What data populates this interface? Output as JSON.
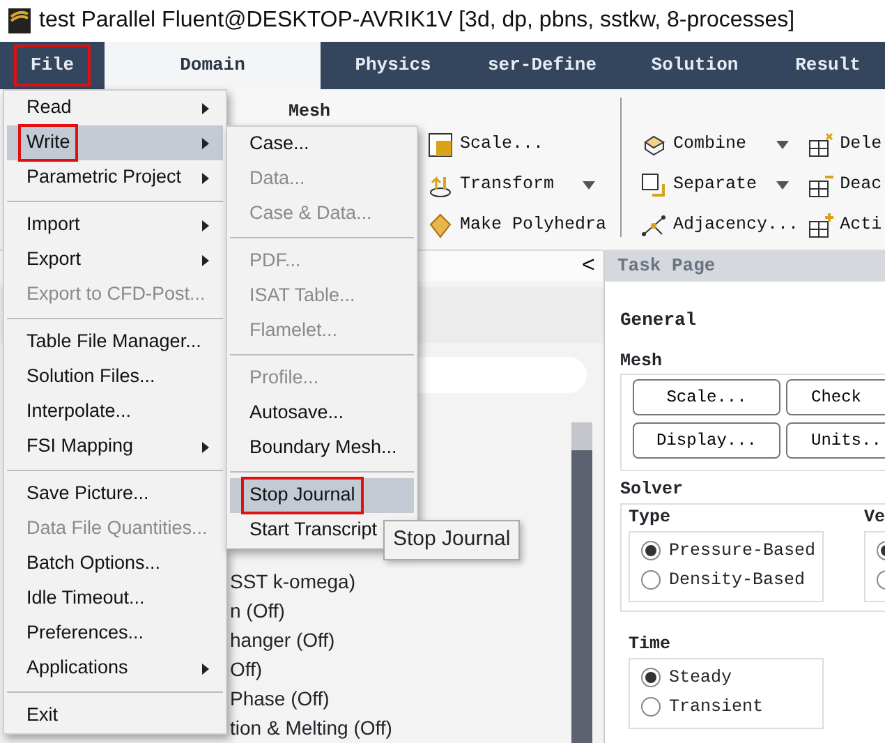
{
  "window": {
    "title": "test Parallel Fluent@DESKTOP-AVRIK1V  [3d, dp, pbns, sstkw, 8-processes]"
  },
  "tabs": [
    {
      "label": "File",
      "selected": false,
      "annotated": true
    },
    {
      "label": "Domain",
      "selected": true,
      "annotated": false
    },
    {
      "label": "Physics",
      "selected": false,
      "annotated": false
    },
    {
      "label": "ser-Define",
      "selected": false,
      "annotated": false
    },
    {
      "label": "Solution",
      "selected": false,
      "annotated": false
    },
    {
      "label": "Result",
      "selected": false,
      "annotated": false
    }
  ],
  "ribbon": {
    "group_title": "Mesh",
    "columns": [
      [
        {
          "label": "Scale...",
          "dropdown": false
        },
        {
          "label": "Transform",
          "dropdown": true
        },
        {
          "label": "Make Polyhedra",
          "dropdown": false
        }
      ],
      [
        {
          "label": "Combine",
          "dropdown": true
        },
        {
          "label": "Separate",
          "dropdown": true
        },
        {
          "label": "Adjacency...",
          "dropdown": false
        }
      ],
      [
        {
          "label": "Dele",
          "dropdown": false
        },
        {
          "label": "Deac",
          "dropdown": false
        },
        {
          "label": "Acti",
          "dropdown": false
        }
      ]
    ]
  },
  "outline_panel": {
    "collapse": "<",
    "items": [
      "SST k-omega)",
      "n (Off)",
      "hanger (Off)",
      "Off)",
      "Phase (Off)",
      "tion & Melting (Off)"
    ]
  },
  "task_page": {
    "title": "Task Page",
    "heading": "General",
    "mesh": {
      "title": "Mesh",
      "buttons": [
        "Scale...",
        "Check",
        "Display...",
        "Units.."
      ]
    },
    "solver": {
      "title": "Solver",
      "type": {
        "title": "Type",
        "options": [
          {
            "label": "Pressure-Based",
            "selected": true
          },
          {
            "label": "Density-Based",
            "selected": false
          }
        ]
      },
      "velocity": {
        "title": "Ve",
        "options": [
          {
            "selected": true
          },
          {
            "selected": false
          }
        ]
      }
    },
    "time": {
      "title": "Time",
      "options": [
        {
          "label": "Steady",
          "selected": true
        },
        {
          "label": "Transient",
          "selected": false
        }
      ]
    }
  },
  "file_menu": [
    {
      "kind": "item",
      "label": "Read",
      "submenu": true,
      "disabled": false,
      "selected": false,
      "annotated": false
    },
    {
      "kind": "item",
      "label": "Write",
      "submenu": true,
      "disabled": false,
      "selected": true,
      "annotated": true
    },
    {
      "kind": "item",
      "label": "Parametric Project",
      "submenu": true,
      "disabled": false,
      "selected": false,
      "annotated": false
    },
    {
      "kind": "separator"
    },
    {
      "kind": "item",
      "label": "Import",
      "submenu": true,
      "disabled": false,
      "selected": false,
      "annotated": false
    },
    {
      "kind": "item",
      "label": "Export",
      "submenu": true,
      "disabled": false,
      "selected": false,
      "annotated": false
    },
    {
      "kind": "item",
      "label": "Export to CFD-Post...",
      "submenu": false,
      "disabled": true,
      "selected": false,
      "annotated": false
    },
    {
      "kind": "separator"
    },
    {
      "kind": "item",
      "label": "Table File Manager...",
      "submenu": false,
      "disabled": false,
      "selected": false,
      "annotated": false
    },
    {
      "kind": "item",
      "label": "Solution Files...",
      "submenu": false,
      "disabled": false,
      "selected": false,
      "annotated": false
    },
    {
      "kind": "item",
      "label": "Interpolate...",
      "submenu": false,
      "disabled": false,
      "selected": false,
      "annotated": false
    },
    {
      "kind": "item",
      "label": "FSI Mapping",
      "submenu": true,
      "disabled": false,
      "selected": false,
      "annotated": false
    },
    {
      "kind": "separator"
    },
    {
      "kind": "item",
      "label": "Save Picture...",
      "submenu": false,
      "disabled": false,
      "selected": false,
      "annotated": false
    },
    {
      "kind": "item",
      "label": "Data File Quantities...",
      "submenu": false,
      "disabled": true,
      "selected": false,
      "annotated": false
    },
    {
      "kind": "item",
      "label": "Batch Options...",
      "submenu": false,
      "disabled": false,
      "selected": false,
      "annotated": false
    },
    {
      "kind": "item",
      "label": "Idle Timeout...",
      "submenu": false,
      "disabled": false,
      "selected": false,
      "annotated": false
    },
    {
      "kind": "item",
      "label": "Preferences...",
      "submenu": false,
      "disabled": false,
      "selected": false,
      "annotated": false
    },
    {
      "kind": "item",
      "label": "Applications",
      "submenu": true,
      "disabled": false,
      "selected": false,
      "annotated": false
    },
    {
      "kind": "separator"
    },
    {
      "kind": "item",
      "label": "Exit",
      "submenu": false,
      "disabled": false,
      "selected": false,
      "annotated": false
    }
  ],
  "write_submenu": [
    {
      "kind": "item",
      "label": "Case...",
      "disabled": false,
      "selected": false,
      "annotated": false
    },
    {
      "kind": "item",
      "label": "Data...",
      "disabled": true,
      "selected": false,
      "annotated": false
    },
    {
      "kind": "item",
      "label": "Case & Data...",
      "disabled": true,
      "selected": false,
      "annotated": false
    },
    {
      "kind": "separator"
    },
    {
      "kind": "item",
      "label": "PDF...",
      "disabled": true,
      "selected": false,
      "annotated": false
    },
    {
      "kind": "item",
      "label": "ISAT Table...",
      "disabled": true,
      "selected": false,
      "annotated": false
    },
    {
      "kind": "item",
      "label": "Flamelet...",
      "disabled": true,
      "selected": false,
      "annotated": false
    },
    {
      "kind": "separator"
    },
    {
      "kind": "item",
      "label": "Profile...",
      "disabled": true,
      "selected": false,
      "annotated": false
    },
    {
      "kind": "item",
      "label": "Autosave...",
      "disabled": false,
      "selected": false,
      "annotated": false
    },
    {
      "kind": "item",
      "label": "Boundary Mesh...",
      "disabled": false,
      "selected": false,
      "annotated": false
    },
    {
      "kind": "separator"
    },
    {
      "kind": "item",
      "label": "Stop Journal",
      "disabled": false,
      "selected": true,
      "annotated": true
    },
    {
      "kind": "item",
      "label": "Start Transcript",
      "disabled": false,
      "selected": false,
      "annotated": false
    }
  ],
  "tooltip": "Stop Journal"
}
